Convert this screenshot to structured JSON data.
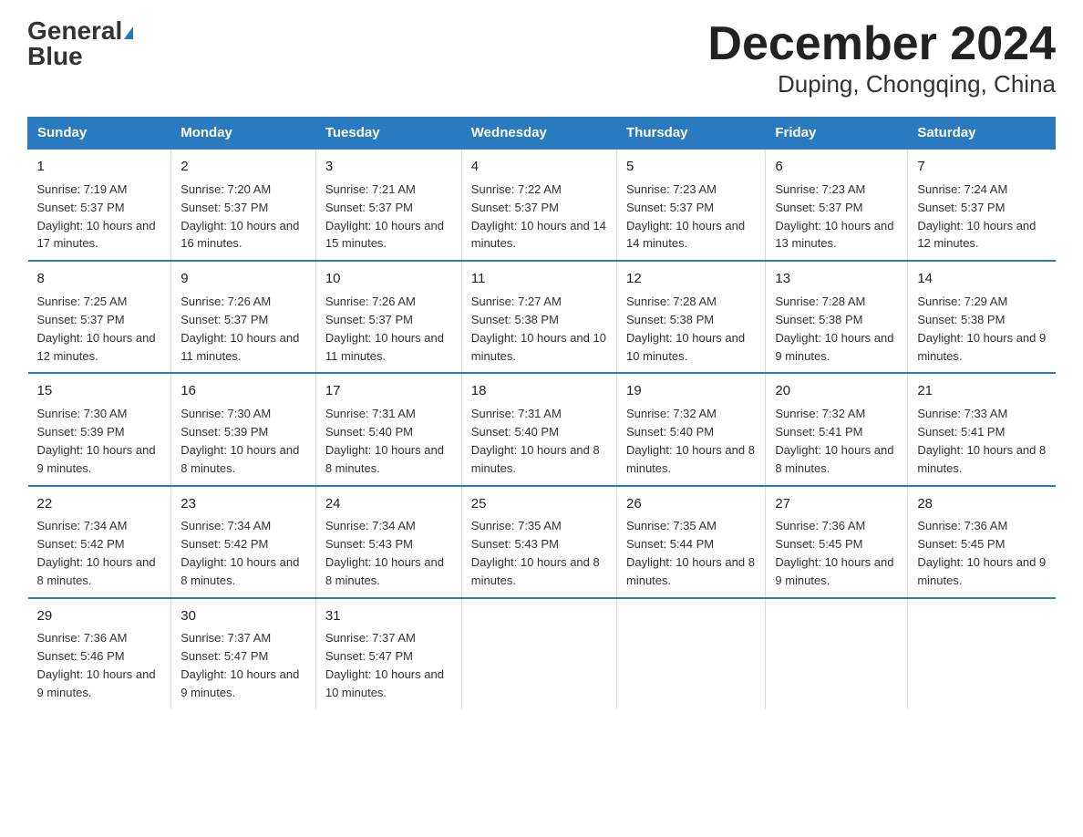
{
  "header": {
    "logo_general": "General",
    "logo_blue": "Blue",
    "title": "December 2024",
    "subtitle": "Duping, Chongqing, China"
  },
  "days_of_week": [
    "Sunday",
    "Monday",
    "Tuesday",
    "Wednesday",
    "Thursday",
    "Friday",
    "Saturday"
  ],
  "weeks": [
    [
      {
        "day": "1",
        "sunrise": "7:19 AM",
        "sunset": "5:37 PM",
        "daylight": "10 hours and 17 minutes."
      },
      {
        "day": "2",
        "sunrise": "7:20 AM",
        "sunset": "5:37 PM",
        "daylight": "10 hours and 16 minutes."
      },
      {
        "day": "3",
        "sunrise": "7:21 AM",
        "sunset": "5:37 PM",
        "daylight": "10 hours and 15 minutes."
      },
      {
        "day": "4",
        "sunrise": "7:22 AM",
        "sunset": "5:37 PM",
        "daylight": "10 hours and 14 minutes."
      },
      {
        "day": "5",
        "sunrise": "7:23 AM",
        "sunset": "5:37 PM",
        "daylight": "10 hours and 14 minutes."
      },
      {
        "day": "6",
        "sunrise": "7:23 AM",
        "sunset": "5:37 PM",
        "daylight": "10 hours and 13 minutes."
      },
      {
        "day": "7",
        "sunrise": "7:24 AM",
        "sunset": "5:37 PM",
        "daylight": "10 hours and 12 minutes."
      }
    ],
    [
      {
        "day": "8",
        "sunrise": "7:25 AM",
        "sunset": "5:37 PM",
        "daylight": "10 hours and 12 minutes."
      },
      {
        "day": "9",
        "sunrise": "7:26 AM",
        "sunset": "5:37 PM",
        "daylight": "10 hours and 11 minutes."
      },
      {
        "day": "10",
        "sunrise": "7:26 AM",
        "sunset": "5:37 PM",
        "daylight": "10 hours and 11 minutes."
      },
      {
        "day": "11",
        "sunrise": "7:27 AM",
        "sunset": "5:38 PM",
        "daylight": "10 hours and 10 minutes."
      },
      {
        "day": "12",
        "sunrise": "7:28 AM",
        "sunset": "5:38 PM",
        "daylight": "10 hours and 10 minutes."
      },
      {
        "day": "13",
        "sunrise": "7:28 AM",
        "sunset": "5:38 PM",
        "daylight": "10 hours and 9 minutes."
      },
      {
        "day": "14",
        "sunrise": "7:29 AM",
        "sunset": "5:38 PM",
        "daylight": "10 hours and 9 minutes."
      }
    ],
    [
      {
        "day": "15",
        "sunrise": "7:30 AM",
        "sunset": "5:39 PM",
        "daylight": "10 hours and 9 minutes."
      },
      {
        "day": "16",
        "sunrise": "7:30 AM",
        "sunset": "5:39 PM",
        "daylight": "10 hours and 8 minutes."
      },
      {
        "day": "17",
        "sunrise": "7:31 AM",
        "sunset": "5:40 PM",
        "daylight": "10 hours and 8 minutes."
      },
      {
        "day": "18",
        "sunrise": "7:31 AM",
        "sunset": "5:40 PM",
        "daylight": "10 hours and 8 minutes."
      },
      {
        "day": "19",
        "sunrise": "7:32 AM",
        "sunset": "5:40 PM",
        "daylight": "10 hours and 8 minutes."
      },
      {
        "day": "20",
        "sunrise": "7:32 AM",
        "sunset": "5:41 PM",
        "daylight": "10 hours and 8 minutes."
      },
      {
        "day": "21",
        "sunrise": "7:33 AM",
        "sunset": "5:41 PM",
        "daylight": "10 hours and 8 minutes."
      }
    ],
    [
      {
        "day": "22",
        "sunrise": "7:34 AM",
        "sunset": "5:42 PM",
        "daylight": "10 hours and 8 minutes."
      },
      {
        "day": "23",
        "sunrise": "7:34 AM",
        "sunset": "5:42 PM",
        "daylight": "10 hours and 8 minutes."
      },
      {
        "day": "24",
        "sunrise": "7:34 AM",
        "sunset": "5:43 PM",
        "daylight": "10 hours and 8 minutes."
      },
      {
        "day": "25",
        "sunrise": "7:35 AM",
        "sunset": "5:43 PM",
        "daylight": "10 hours and 8 minutes."
      },
      {
        "day": "26",
        "sunrise": "7:35 AM",
        "sunset": "5:44 PM",
        "daylight": "10 hours and 8 minutes."
      },
      {
        "day": "27",
        "sunrise": "7:36 AM",
        "sunset": "5:45 PM",
        "daylight": "10 hours and 9 minutes."
      },
      {
        "day": "28",
        "sunrise": "7:36 AM",
        "sunset": "5:45 PM",
        "daylight": "10 hours and 9 minutes."
      }
    ],
    [
      {
        "day": "29",
        "sunrise": "7:36 AM",
        "sunset": "5:46 PM",
        "daylight": "10 hours and 9 minutes."
      },
      {
        "day": "30",
        "sunrise": "7:37 AM",
        "sunset": "5:47 PM",
        "daylight": "10 hours and 9 minutes."
      },
      {
        "day": "31",
        "sunrise": "7:37 AM",
        "sunset": "5:47 PM",
        "daylight": "10 hours and 10 minutes."
      },
      null,
      null,
      null,
      null
    ]
  ]
}
